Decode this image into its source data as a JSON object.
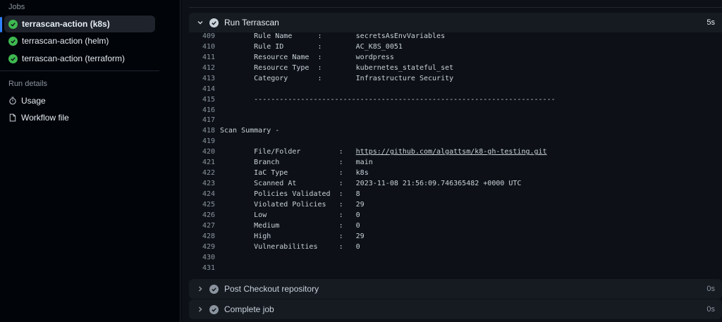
{
  "sidebar": {
    "jobs_label": "Jobs",
    "jobs": [
      {
        "label": "terrascan-action (k8s)",
        "status": "success",
        "active": true
      },
      {
        "label": "terrascan-action (helm)",
        "status": "success",
        "active": false
      },
      {
        "label": "terrascan-action (terraform)",
        "status": "success",
        "active": false
      }
    ],
    "run_details_label": "Run details",
    "details": [
      {
        "label": "Usage",
        "icon": "stopwatch-icon"
      },
      {
        "label": "Workflow file",
        "icon": "file-icon"
      }
    ]
  },
  "steps": {
    "current": {
      "name": "Run Terrascan",
      "time": "5s",
      "expanded": true
    },
    "collapsed": [
      {
        "name": "Post Checkout repository",
        "time": "0s"
      },
      {
        "name": "Complete job",
        "time": "0s"
      }
    ]
  },
  "log": {
    "lines": [
      {
        "n": "409",
        "text": "        Rule Name      :        secretsAsEnvVariables"
      },
      {
        "n": "410",
        "text": "        Rule ID        :        AC_K8S_0051"
      },
      {
        "n": "411",
        "text": "        Resource Name  :        wordpress"
      },
      {
        "n": "412",
        "text": "        Resource Type  :        kubernetes_stateful_set"
      },
      {
        "n": "413",
        "text": "        Category       :        Infrastructure Security"
      },
      {
        "n": "414",
        "text": ""
      },
      {
        "n": "415",
        "text": "        -----------------------------------------------------------------------"
      },
      {
        "n": "416",
        "text": ""
      },
      {
        "n": "417",
        "text": ""
      },
      {
        "n": "418",
        "text": "Scan Summary -"
      },
      {
        "n": "419",
        "text": ""
      },
      {
        "n": "420",
        "text": "        File/Folder         :   ",
        "link": "https://github.com/algattsm/k8-gh-testing.git"
      },
      {
        "n": "421",
        "text": "        Branch              :   main"
      },
      {
        "n": "422",
        "text": "        IaC Type            :   k8s"
      },
      {
        "n": "423",
        "text": "        Scanned At          :   2023-11-08 21:56:09.746365482 +0000 UTC"
      },
      {
        "n": "424",
        "text": "        Policies Validated  :   8"
      },
      {
        "n": "425",
        "text": "        Violated Policies   :   29"
      },
      {
        "n": "426",
        "text": "        Low                 :   0"
      },
      {
        "n": "427",
        "text": "        Medium              :   0"
      },
      {
        "n": "428",
        "text": "        High                :   29"
      },
      {
        "n": "429",
        "text": "        Vulnerabilities     :   0"
      },
      {
        "n": "430",
        "text": ""
      },
      {
        "n": "431",
        "text": ""
      }
    ]
  },
  "colors": {
    "success": "#3fb950",
    "active_accent": "#2f81f7",
    "bg": "#0d1117",
    "sidebar_bg": "#010409"
  }
}
